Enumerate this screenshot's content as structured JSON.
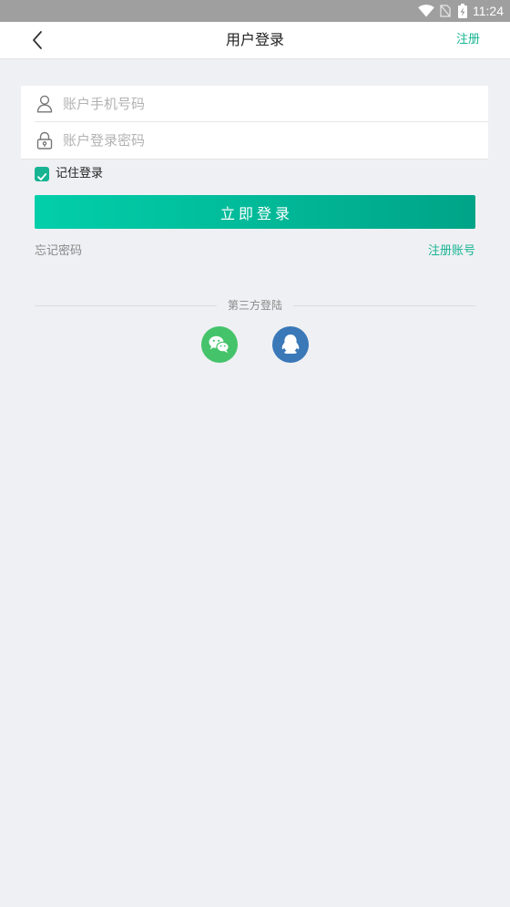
{
  "status_bar": {
    "time": "11:24",
    "icons": [
      "wifi-icon",
      "no-sim-icon",
      "battery-charging-icon"
    ]
  },
  "header": {
    "back_icon": "chevron-left-icon",
    "title": "用户登录",
    "register_label": "注册"
  },
  "form": {
    "phone": {
      "icon": "user-icon",
      "placeholder": "账户手机号码"
    },
    "password": {
      "icon": "lock-icon",
      "placeholder": "账户登录密码"
    }
  },
  "remember": {
    "label": "记住登录",
    "checked": true
  },
  "login_button": {
    "label": "立即登录"
  },
  "links": {
    "forgot_password": "忘记密码",
    "register_account": "注册账号"
  },
  "third_party": {
    "title": "第三方登陆",
    "providers": [
      {
        "icon": "wechat-icon"
      },
      {
        "icon": "qq-icon"
      }
    ]
  },
  "colors": {
    "accent": "#17b493",
    "button_start": "#02cfaa",
    "button_end": "#00a487",
    "background": "#eff0f3",
    "status_bar": "#9f9f9f",
    "wechat": "#45c36b",
    "qq": "#3a78b8"
  }
}
